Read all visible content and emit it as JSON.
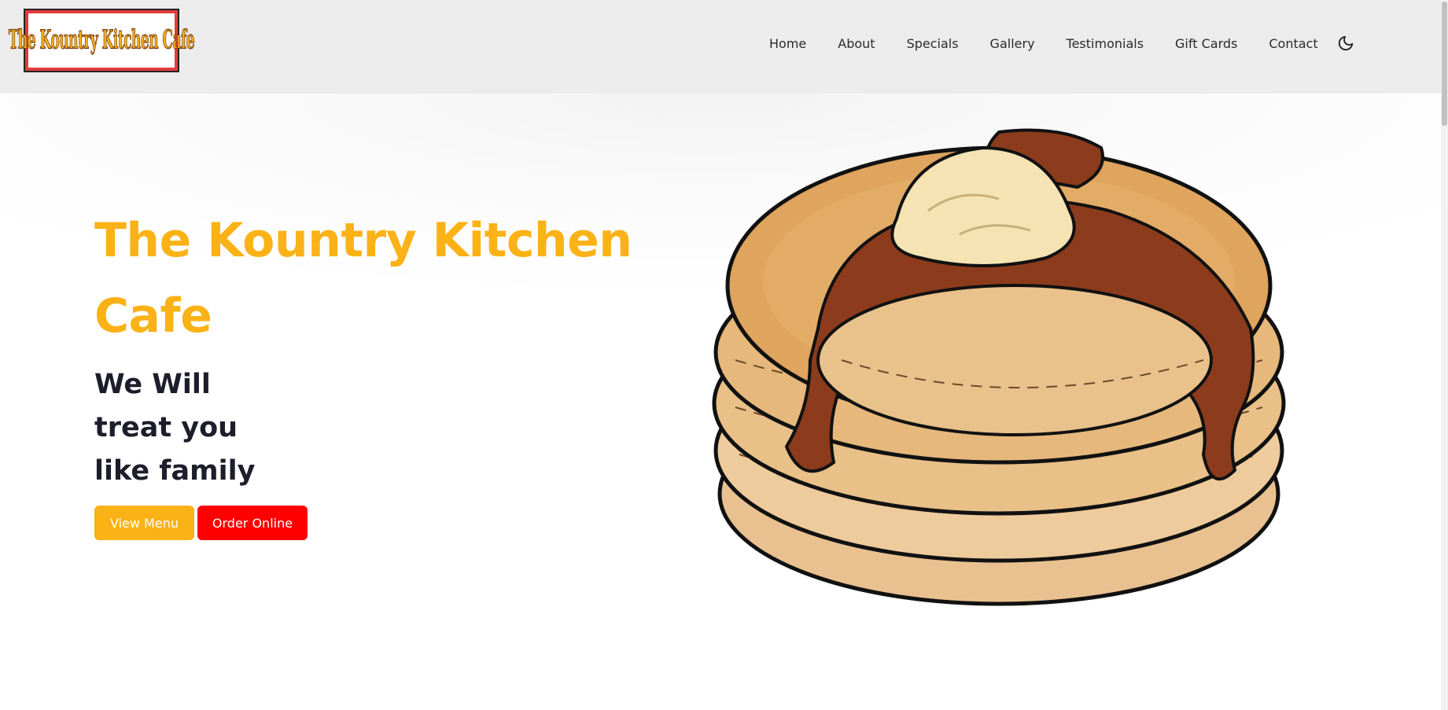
{
  "header": {
    "logo_text": "The Kountry Kitchen Cafe",
    "nav": [
      "Home",
      "About",
      "Specials",
      "Gallery",
      "Testimonials",
      "Gift Cards",
      "Contact"
    ],
    "theme_toggle_icon": "moon-icon"
  },
  "hero": {
    "title": "The Kountry Kitchen Cafe",
    "tagline": [
      "We Will",
      "treat you",
      "like family"
    ],
    "buttons": {
      "view_menu": "View Menu",
      "order_online": "Order Online"
    },
    "image": "pancake-stack-illustration"
  },
  "colors": {
    "accent": "#fbb216",
    "order_button": "#ff0000",
    "header_bg": "#ececec",
    "text_dark": "#1d1d2b"
  }
}
